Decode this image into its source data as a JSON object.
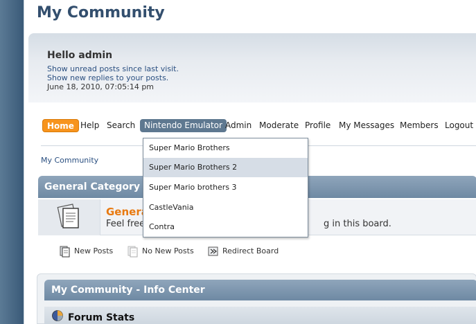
{
  "site": {
    "title": "My Community"
  },
  "user": {
    "greeting": "Hello admin",
    "links": [
      "Show unread posts since last visit.",
      "Show new replies to your posts."
    ],
    "datetime": "June 18, 2010, 07:05:14 pm"
  },
  "menu": {
    "items": [
      "Home",
      "Help",
      "Search",
      "Nintendo Emulator",
      "Admin",
      "Moderate",
      "Profile",
      "My Messages",
      "Members",
      "Logout"
    ],
    "active": "Nintendo Emulator"
  },
  "dropdown": {
    "items": [
      "Super Mario Brothers",
      "Super Mario Brothers 2",
      "Super Mario brothers 3",
      "CastleVania",
      "Contra"
    ],
    "hovered": "Super Mario Brothers 2"
  },
  "breadcrumb": "My Community",
  "category": {
    "title": "General Category",
    "board_name": "Genera",
    "board_desc": "Feel free",
    "board_desc_tail": "g in this board."
  },
  "legend": [
    "New Posts",
    "No New Posts",
    "Redirect Board"
  ],
  "info": {
    "title": "My Community - Info Center",
    "stats_title": "Forum Stats"
  },
  "colors": {
    "accent": "#f7941d",
    "header": "#334f6e",
    "menu_active": "#5e7890",
    "board_link": "#e87a11"
  }
}
